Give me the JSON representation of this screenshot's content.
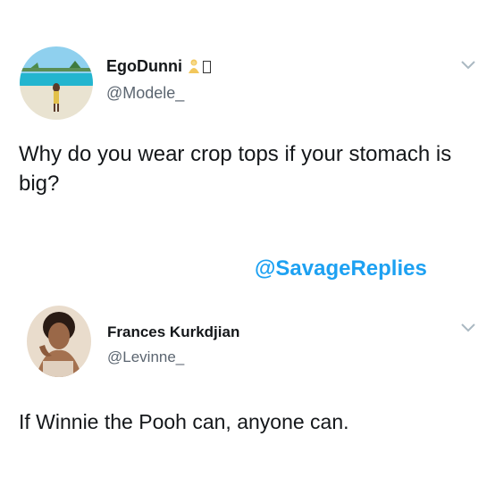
{
  "tweets": [
    {
      "display_name": "EgoDunni",
      "handle": "@Modele_",
      "text": "Why do you wear crop tops if your stomach is big?",
      "name_emoji": "woman-emoji-icon"
    },
    {
      "display_name": "Frances Kurkdjian",
      "handle": "@Levinne_",
      "text": "If Winnie the Pooh can, anyone can."
    }
  ],
  "watermark": "@SavageReplies",
  "colors": {
    "text": "#14171a",
    "handle": "#5b6570",
    "watermark": "#1da1f2",
    "caret": "#aab8c2"
  }
}
